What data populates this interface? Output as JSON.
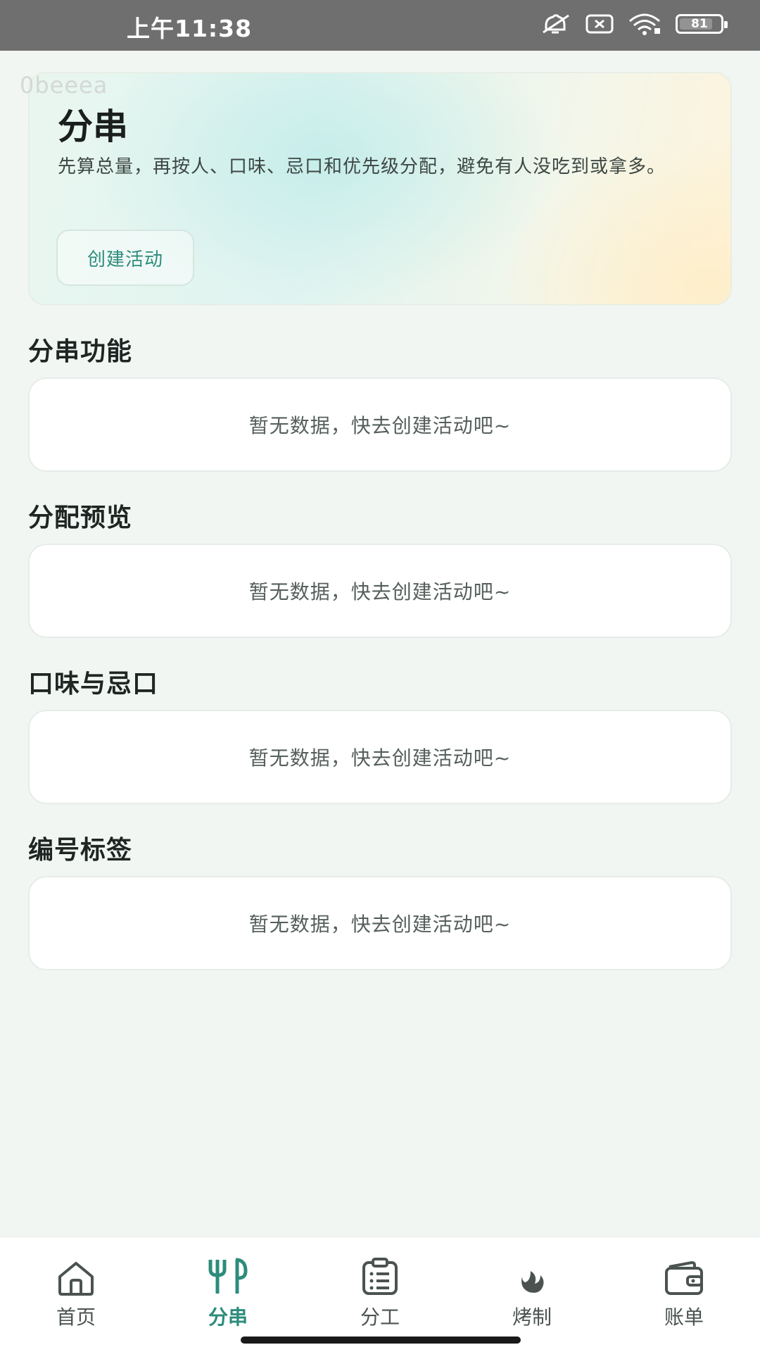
{
  "status_bar": {
    "time": "上午11:38",
    "battery": "81",
    "icons": [
      "mute-icon",
      "sim-icon",
      "wifi-icon",
      "battery-icon"
    ]
  },
  "debug_text": "0beeea",
  "hero": {
    "title": "分串",
    "description": "先算总量，再按人、口味、忌口和优先级分配，避免有人没吃到或拿多。",
    "button_label": "创建活动"
  },
  "sections": [
    {
      "title": "分串功能",
      "empty_text": "暂无数据，快去创建活动吧~"
    },
    {
      "title": "分配预览",
      "empty_text": "暂无数据，快去创建活动吧~"
    },
    {
      "title": "口味与忌口",
      "empty_text": "暂无数据，快去创建活动吧~"
    },
    {
      "title": "编号标签",
      "empty_text": "暂无数据，快去创建活动吧~"
    }
  ],
  "nav": {
    "items": [
      {
        "label": "首页",
        "icon": "home-icon",
        "active": false
      },
      {
        "label": "分串",
        "icon": "fork-knife-icon",
        "active": true
      },
      {
        "label": "分工",
        "icon": "clipboard-icon",
        "active": false
      },
      {
        "label": "烤制",
        "icon": "flame-icon",
        "active": false
      },
      {
        "label": "账单",
        "icon": "wallet-icon",
        "active": false
      }
    ]
  },
  "colors": {
    "accent": "#2d8c7c",
    "background": "#f2f6f3",
    "status_bar": "#6f6f6f"
  }
}
